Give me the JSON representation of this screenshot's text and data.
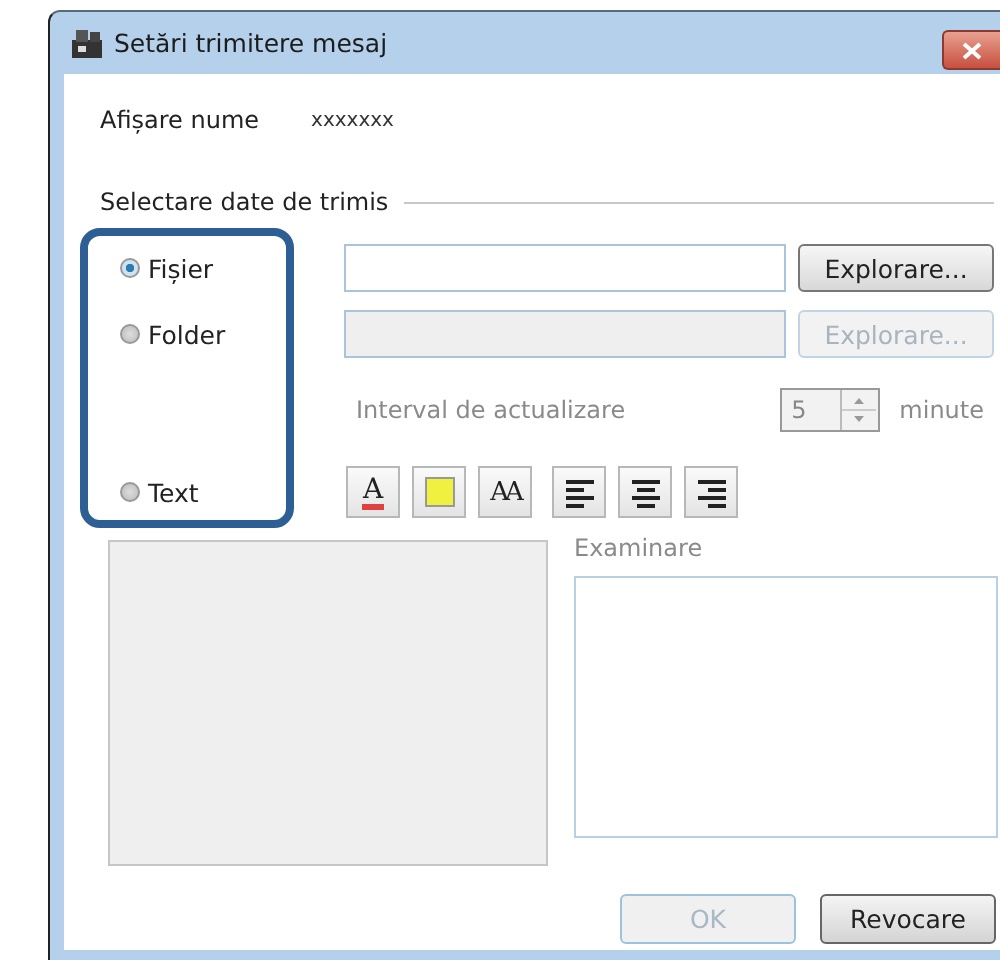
{
  "window": {
    "title": "Setări trimitere mesaj"
  },
  "display_name": {
    "label": "Afișare nume",
    "value": "xxxxxxx"
  },
  "section": {
    "title": "Selectare date de trimis"
  },
  "sources": [
    {
      "label": "Fișier",
      "selected": true
    },
    {
      "label": "Folder",
      "selected": false
    },
    {
      "label": "Text",
      "selected": false
    }
  ],
  "file_path": {
    "browse": "Explorare...",
    "disabled": false
  },
  "folder_path": {
    "browse": "Explorare...",
    "disabled": true
  },
  "interval": {
    "label": "Interval de actualizare",
    "value": "5",
    "unit": "minute",
    "disabled": true
  },
  "format_buttons": [
    {
      "kind": "font-color",
      "glyph": "A"
    },
    {
      "kind": "background-color"
    },
    {
      "kind": "font-size",
      "glyph": "AA"
    },
    {
      "kind": "align-left"
    },
    {
      "kind": "align-center"
    },
    {
      "kind": "align-right"
    }
  ],
  "preview": {
    "label": "Examinare"
  },
  "buttons": [
    {
      "label": "OK",
      "disabled": true
    },
    {
      "label": "Revocare",
      "disabled": false
    }
  ]
}
